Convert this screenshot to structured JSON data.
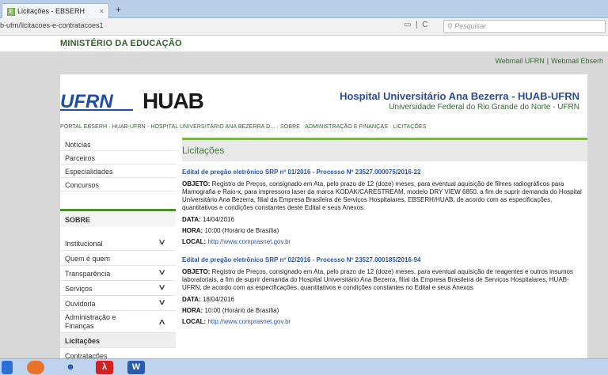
{
  "browser": {
    "tab_title": "Licitações - EBSERH",
    "tab_close": "×",
    "new_tab": "+",
    "url": "b-ufrn/licitacoes-e-contratacoes1",
    "search_placeholder": "Pesquisar"
  },
  "header": {
    "ministry": "MINISTÉRIO DA EDUCAÇÃO",
    "webmail_ufrn": "Webmail UFRN",
    "webmail_ebserh": "Webmail Ebserh",
    "logo_ufrn": "UFRN",
    "logo_huab": "HUAB",
    "hospital_title": "Hospital Universitário Ana Bezerra - HUAB-UFRN",
    "hospital_subtitle": "Universidade Federal do Rio Grande do Norte - UFRN"
  },
  "breadcrumb": {
    "portal": "PORTAL EBSERH",
    "huab": "HUAB-UFRN - HOSPITAL UNIVERSITÁRIO ANA BEZERRA D...",
    "sobre": "SOBRE",
    "admin": "ADMINISTRAÇÃO E FINANÇAS",
    "licitacoes": "LICITAÇÕES"
  },
  "sidebar": {
    "links": [
      "Notícias",
      "Parceiros",
      "Especialidades",
      "Concursos"
    ],
    "section_title": "SOBRE",
    "menu": [
      {
        "label": "Institucional",
        "expandable": true
      },
      {
        "label": "Quem é quem",
        "expandable": false
      },
      {
        "label": "Transparência",
        "expandable": true
      },
      {
        "label": "Serviços",
        "expandable": true
      },
      {
        "label": "Ouvidoria",
        "expandable": true
      },
      {
        "label": "Administração e Finanças",
        "expandable": true
      },
      {
        "label": "Licitações",
        "expandable": false
      },
      {
        "label": "Contratações",
        "expandable": false
      }
    ]
  },
  "main": {
    "title": "Licitações",
    "entries": [
      {
        "title": "Edital de pregão eletrônico SRP nº 01/2016 - Processo Nº 23527.000075/2016-22",
        "objeto_label": "OBJETO:",
        "objeto": "Registro de Preços, consignado em Ata, pelo prazo de 12 (doze) meses, para eventual aquisição de filmes radiográficos para Mamografia e Raio-x, para impressora laser da marca KODAK/CARESTREAM, modelo DRY VIEW 6850, a fim de suprir demanda do Hospital Universitário Ana Bezerra, filial da Empresa Brasileira de Serviços Hospitalares, EBSERH/HUAB, de acordo com as especificações, quantitativos e condições constantes deste Edital e seus Anexos.",
        "data_label": "DATA:",
        "data": "14/04/2016",
        "hora_label": "HORA:",
        "hora": "10:00 (Horário de Brasília)",
        "local_label": "LOCAL:",
        "local": "http://www.comprasnet.gov.br"
      },
      {
        "title": "Edital de pregão eletrônico SRP nº 02/2016 - Processo Nº 23527.000185/2016-94",
        "objeto_label": "OBJETO:",
        "objeto": "Registro de Preços, consignado em Ata, pelo prazo de 12 (doze) meses, para eventual aquisição de reagentes e outros insumos laboratoriais, a fim de suprir demanda do Hospital Universitário Ana Bezerra, filial da Empresa Brasileira de Serviços Hospitalares, HUAB-UFRN, de acordo com as especificações, quantitativos e condições constantes no Edital e seus Anexos",
        "data_label": "DATA:",
        "data": "18/04/2016",
        "hora_label": "HORA:",
        "hora": "10:00 (Horário de Brasília)",
        "local_label": "LOCAL:",
        "local": "http://www.comprasnet.gov.br"
      }
    ]
  },
  "colors": {
    "accent_green": "#4f8e2f",
    "title_blue": "#2b55a3",
    "hospital_blue": "#2b4d93"
  }
}
